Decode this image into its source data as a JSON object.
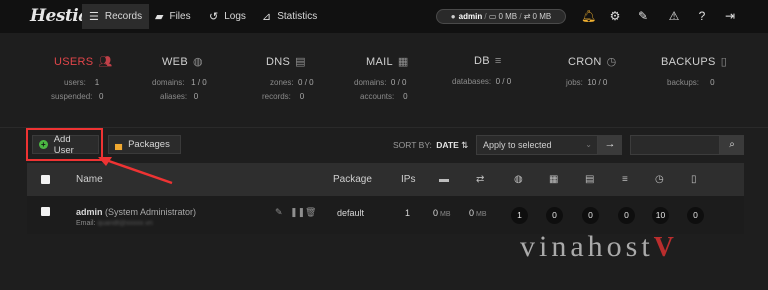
{
  "topbar": {
    "logo": "Hestia",
    "nav": [
      {
        "label": "Records",
        "icon": "list-icon",
        "active": true
      },
      {
        "label": "Files",
        "icon": "folder-icon",
        "active": false
      },
      {
        "label": "Logs",
        "icon": "history-icon",
        "active": false
      },
      {
        "label": "Statistics",
        "icon": "chart-icon",
        "active": false
      }
    ],
    "user_pill": {
      "user": "admin",
      "sep": " / ",
      "disk": "0",
      "disk_unit": "MB",
      "bandwidth": "0",
      "bandwidth_unit": "MB"
    },
    "icons": [
      "bell-icon",
      "gear-icon",
      "user-edit-icon",
      "warning-icon",
      "help-icon",
      "logout-icon"
    ],
    "accent": "#e0454a"
  },
  "stats": [
    {
      "title": "USERS",
      "icon": "users-icon",
      "rows": [
        [
          "users:",
          "1"
        ],
        [
          "suspended:",
          "0"
        ]
      ]
    },
    {
      "title": "WEB",
      "icon": "globe-icon",
      "rows": [
        [
          "domains:",
          "1 / 0"
        ],
        [
          "aliases:",
          "0"
        ]
      ]
    },
    {
      "title": "DNS",
      "icon": "dns-icon",
      "rows": [
        [
          "zones:",
          "0 / 0"
        ],
        [
          "records:",
          "0"
        ]
      ]
    },
    {
      "title": "MAIL",
      "icon": "mail-icon",
      "rows": [
        [
          "domains:",
          "0 / 0"
        ],
        [
          "accounts:",
          "0"
        ]
      ]
    },
    {
      "title": "DB",
      "icon": "database-icon",
      "rows": [
        [
          "databases:",
          "0 / 0"
        ]
      ]
    },
    {
      "title": "CRON",
      "icon": "clock-icon",
      "rows": [
        [
          "jobs:",
          "10 / 0"
        ]
      ]
    },
    {
      "title": "BACKUPS",
      "icon": "file-icon",
      "rows": [
        [
          "backups:",
          "0"
        ]
      ]
    }
  ],
  "toolbar": {
    "add_user": "Add User",
    "packages": "Packages",
    "sort_label": "SORT BY:",
    "sort_value": "DATE",
    "bulk_select": "Apply to selected",
    "search_placeholder": ""
  },
  "table": {
    "headers": {
      "name": "Name",
      "package": "Package",
      "ips": "IPs"
    },
    "rows": [
      {
        "name": "admin",
        "role": "(System Administrator)",
        "email_label": "Email:",
        "email": "quandt@xxxxx.vn",
        "package": "default",
        "ips": "1",
        "disk": "0",
        "disk_unit": "MB",
        "bandwidth": "0",
        "bandwidth_unit": "MB",
        "web": "1",
        "dns": "0",
        "mail": "0",
        "db": "0",
        "cron": "10",
        "backups": "0"
      }
    ]
  },
  "watermark": {
    "text": "vinahost",
    "mark": "V"
  }
}
